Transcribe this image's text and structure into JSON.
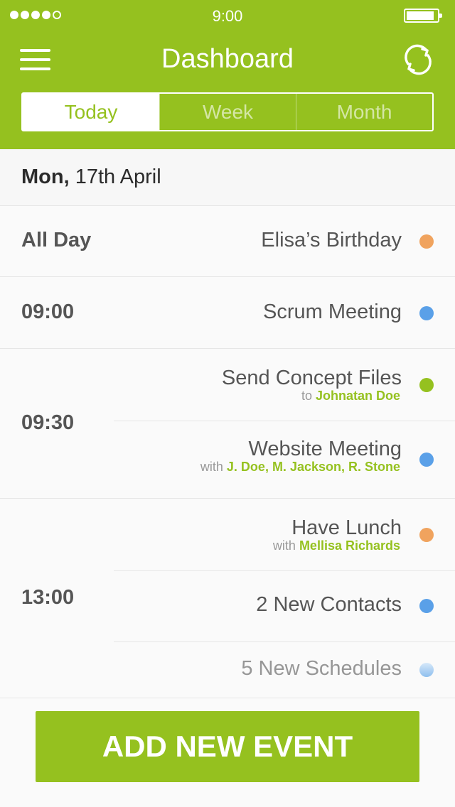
{
  "status_bar": {
    "time": "9:00",
    "signal_bars": 4,
    "signal_total": 5
  },
  "header": {
    "title": "Dashboard",
    "tabs": [
      {
        "label": "Today",
        "active": true
      },
      {
        "label": "Week",
        "active": false
      },
      {
        "label": "Month",
        "active": false
      }
    ]
  },
  "date": {
    "weekday": "Mon,",
    "rest": "17th April"
  },
  "schedule": [
    {
      "time": "All Day",
      "events": [
        {
          "name": "Elisa’s Birthday",
          "color": "#f0a35e"
        }
      ]
    },
    {
      "time": "09:00",
      "events": [
        {
          "name": "Scrum Meeting",
          "color": "#5aa0e8"
        }
      ]
    },
    {
      "time": "09:30",
      "events": [
        {
          "name": "Send Concept Files",
          "prefix": "to",
          "people": "Johnatan Doe",
          "color": "#95c11f"
        },
        {
          "name": "Website Meeting",
          "prefix": "with",
          "people": "J. Doe, M. Jackson, R. Stone",
          "color": "#5aa0e8"
        }
      ]
    },
    {
      "time": "13:00",
      "events": [
        {
          "name": "Have Lunch",
          "prefix": "with",
          "people": "Mellisa Richards",
          "color": "#f0a35e"
        },
        {
          "name": "2 New Contacts",
          "color": "#5aa0e8"
        },
        {
          "name": "5 New Schedules",
          "color": "#5aa0e8",
          "faded": true
        }
      ]
    }
  ],
  "add_button": {
    "label": "ADD NEW EVENT"
  },
  "colors": {
    "brand": "#95c11f",
    "orange": "#f0a35e",
    "blue": "#5aa0e8"
  }
}
